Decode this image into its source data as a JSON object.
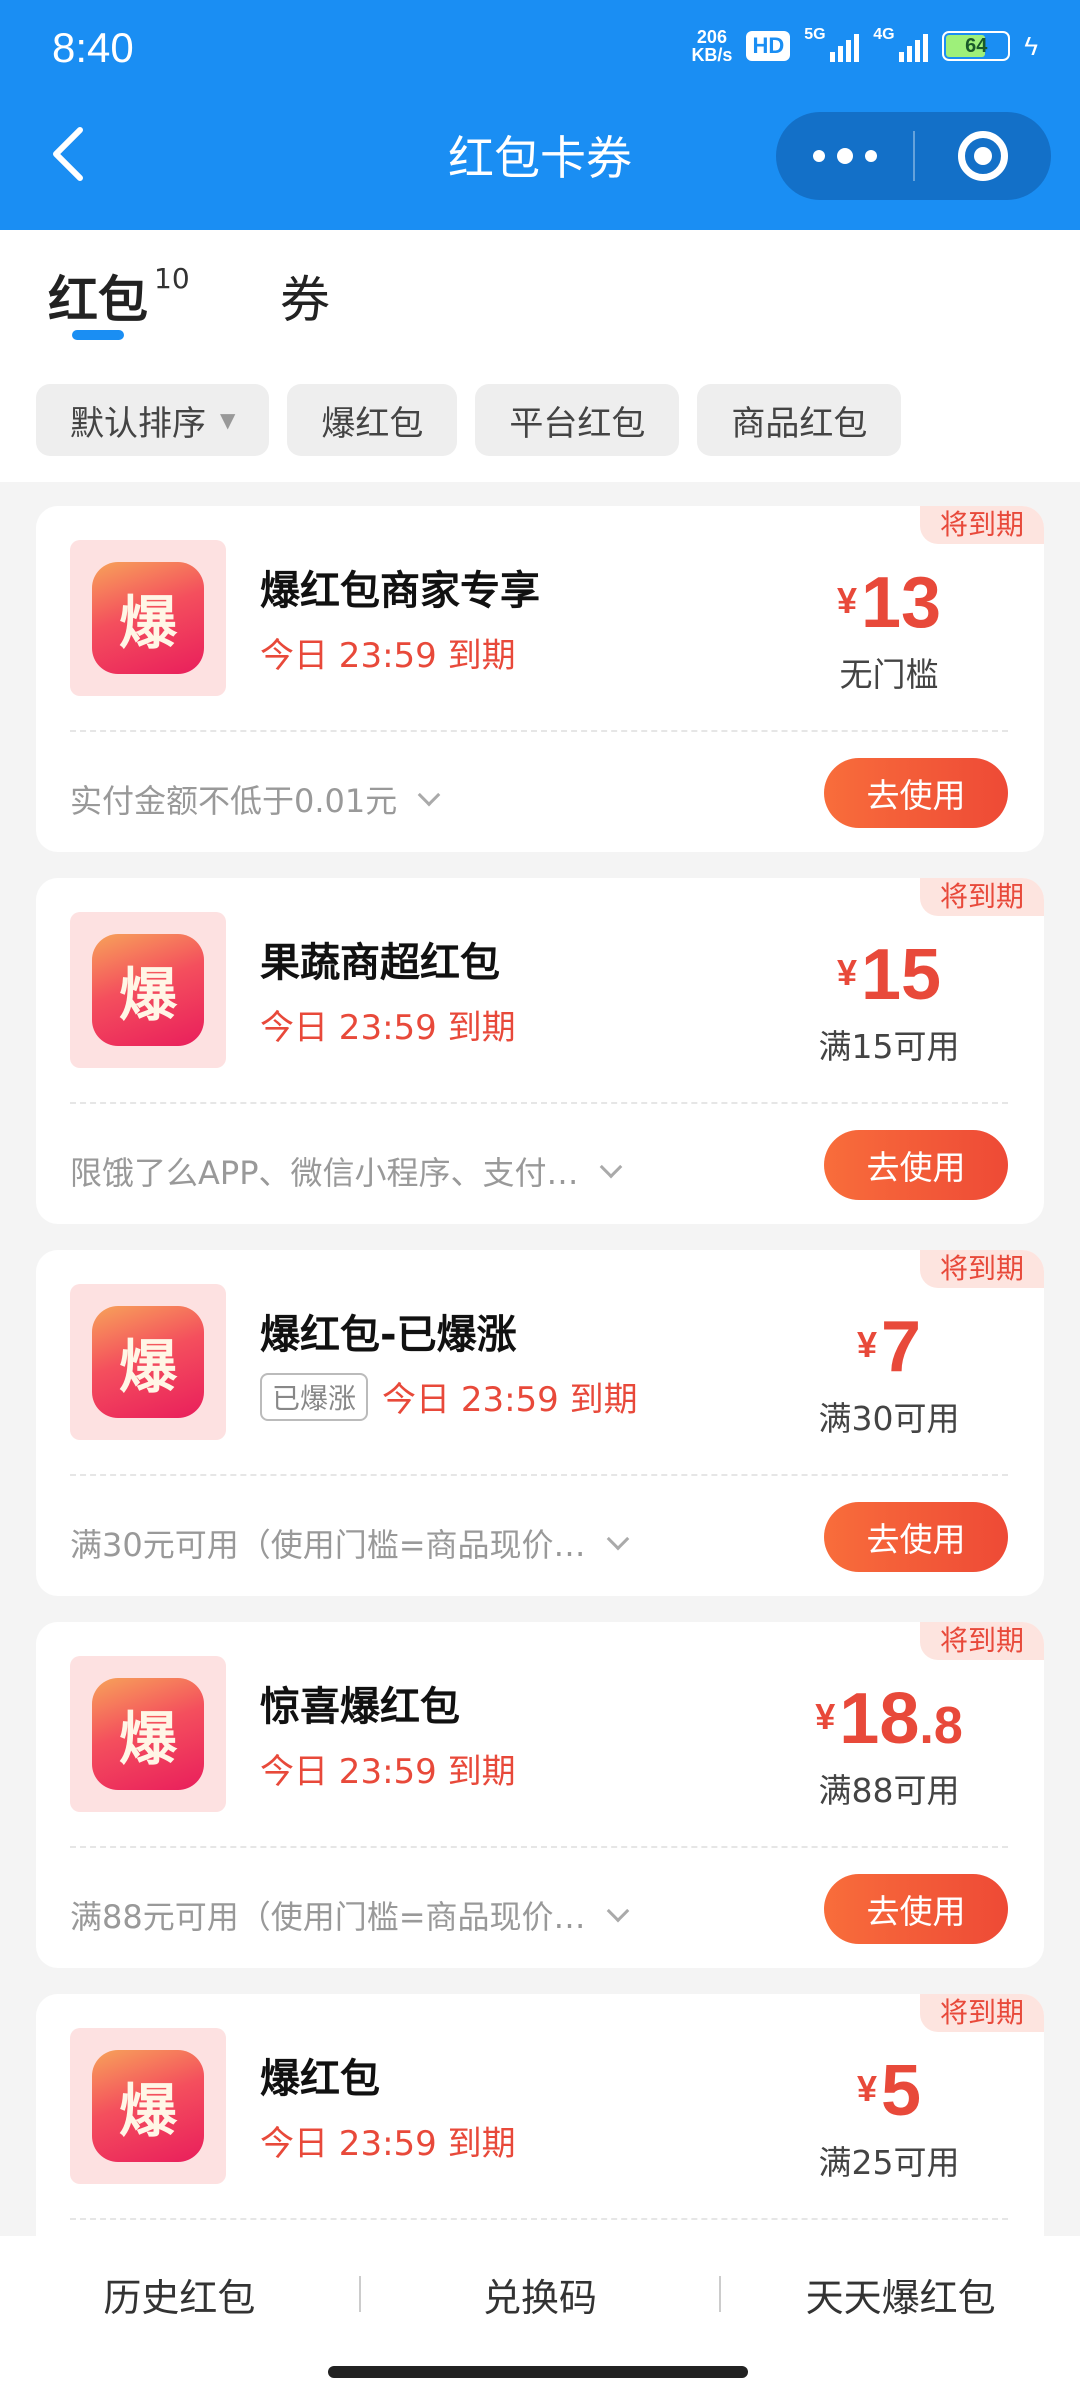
{
  "status_bar": {
    "time": "8:40",
    "net_speed": "206",
    "net_unit": "KB/s",
    "hd": "HD",
    "signal1": "5G",
    "signal2": "4G",
    "battery": "64"
  },
  "header": {
    "title": "红包卡券"
  },
  "tabs": [
    {
      "label": "红包",
      "count": "10"
    },
    {
      "label": "券"
    }
  ],
  "filters": [
    "默认排序",
    "爆红包",
    "平台红包",
    "商品红包"
  ],
  "cards": [
    {
      "tag": "将到期",
      "logo_char": "爆",
      "name": "爆红包商家专享",
      "badge": "",
      "expire": "今日 23:59 到期",
      "currency": "¥",
      "amount_int": "13",
      "amount_dec": "",
      "condition": "无门槛",
      "desc": "实付金额不低于0.01元",
      "button": "去使用"
    },
    {
      "tag": "将到期",
      "logo_char": "爆",
      "name": "果蔬商超红包",
      "badge": "",
      "expire": "今日 23:59 到期",
      "currency": "¥",
      "amount_int": "15",
      "amount_dec": "",
      "condition": "满15可用",
      "desc": "限饿了么APP、微信小程序、支付…",
      "button": "去使用"
    },
    {
      "tag": "将到期",
      "logo_char": "爆",
      "name": "爆红包-已爆涨",
      "badge": "已爆涨",
      "expire": "今日 23:59 到期",
      "currency": "¥",
      "amount_int": "7",
      "amount_dec": "",
      "condition": "满30可用",
      "desc": "满30元可用（使用门槛=商品现价…",
      "button": "去使用"
    },
    {
      "tag": "将到期",
      "logo_char": "爆",
      "name": "惊喜爆红包",
      "badge": "",
      "expire": "今日 23:59 到期",
      "currency": "¥",
      "amount_int": "18",
      "amount_dec": ".8",
      "condition": "满88可用",
      "desc": "满88元可用（使用门槛=商品现价…",
      "button": "去使用"
    },
    {
      "tag": "将到期",
      "logo_char": "爆",
      "name": "爆红包",
      "badge": "",
      "expire": "今日 23:59 到期",
      "currency": "¥",
      "amount_int": "5",
      "amount_dec": "",
      "condition": "满25可用",
      "desc": "",
      "button": ""
    }
  ],
  "bottom_links": [
    "历史红包",
    "兑换码",
    "天天爆红包"
  ],
  "colors": {
    "header_blue": "#1a8ef3",
    "accent_red": "#e8493a",
    "button_orange": "#f86d3b"
  }
}
